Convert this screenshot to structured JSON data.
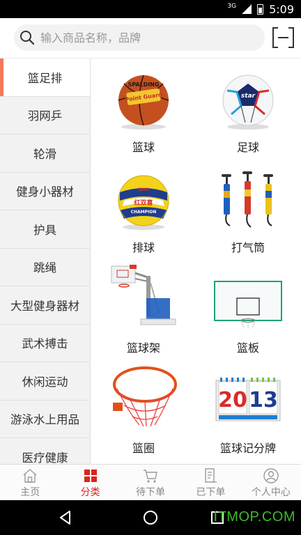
{
  "status_bar": {
    "signal_label": "3G",
    "time": "5:09"
  },
  "search": {
    "placeholder": "输入商品名称，品牌"
  },
  "sidebar": {
    "items": [
      {
        "label": "篮足排",
        "active": true
      },
      {
        "label": "羽网乒"
      },
      {
        "label": "轮滑"
      },
      {
        "label": "健身小器材"
      },
      {
        "label": "护具"
      },
      {
        "label": "跳绳"
      },
      {
        "label": "大型健身器材"
      },
      {
        "label": "武术搏击"
      },
      {
        "label": "休闲运动"
      },
      {
        "label": "游泳水上用品"
      },
      {
        "label": "医疗健康"
      }
    ]
  },
  "products": [
    {
      "name": "篮球",
      "icon": "basketball-image"
    },
    {
      "name": "足球",
      "icon": "soccer-ball-image"
    },
    {
      "name": "排球",
      "icon": "volleyball-image"
    },
    {
      "name": "打气筒",
      "icon": "air-pump-image"
    },
    {
      "name": "篮球架",
      "icon": "basketball-stand-image"
    },
    {
      "name": "篮板",
      "icon": "backboard-image"
    },
    {
      "name": "篮圈",
      "icon": "hoop-image"
    },
    {
      "name": "篮球记分牌",
      "icon": "scoreboard-image"
    }
  ],
  "image_text": {
    "basketball_brand": "SPALDING",
    "basketball_model": "Point Guard",
    "soccer_brand": "star",
    "volleyball_brand": "DHS",
    "volleyball_text": "红双喜",
    "volleyball_text2": "CHAMPION",
    "scoreboard_left": "20",
    "scoreboard_right": "13"
  },
  "bottom_nav": [
    {
      "label": "主页",
      "icon": "home-icon"
    },
    {
      "label": "分类",
      "icon": "category-icon",
      "active": true
    },
    {
      "label": "待下单",
      "icon": "cart-icon"
    },
    {
      "label": "已下单",
      "icon": "order-list-icon"
    },
    {
      "label": "个人中心",
      "icon": "user-icon"
    }
  ],
  "watermark": "ITMOP.COM",
  "colors": {
    "accent": "#d9251c",
    "active_bar": "#f27a5b",
    "watermark": "#3fba2c"
  }
}
